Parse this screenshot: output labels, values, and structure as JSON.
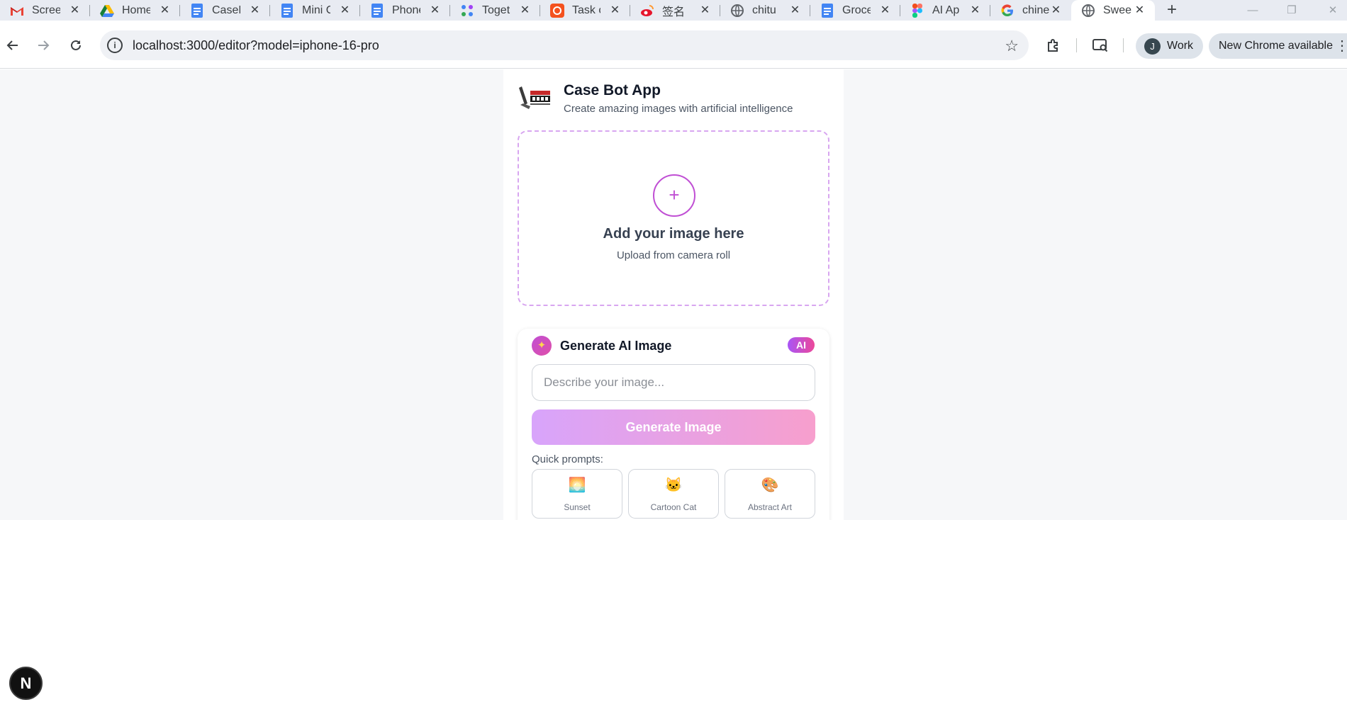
{
  "browser": {
    "tabs": [
      {
        "title": "Screen",
        "icon": "gmail-icon"
      },
      {
        "title": "Home",
        "icon": "google-drive-icon"
      },
      {
        "title": "CaseBot",
        "icon": "google-docs-icon"
      },
      {
        "title": "Mini C",
        "icon": "google-docs-icon"
      },
      {
        "title": "Phone",
        "icon": "google-docs-icon"
      },
      {
        "title": "Together",
        "icon": "apps-icon"
      },
      {
        "title": "Task c",
        "icon": "orange-app-icon"
      },
      {
        "title": "签名",
        "icon": "weibo-icon"
      },
      {
        "title": "chitu",
        "icon": "globe-icon"
      },
      {
        "title": "Groce",
        "icon": "google-docs-icon"
      },
      {
        "title": "AI Ap",
        "icon": "figma-icon"
      },
      {
        "title": "chine",
        "icon": "google-icon"
      },
      {
        "title": "Swee",
        "icon": "globe-icon"
      }
    ],
    "url": "localhost:3000/editor?model=iphone-16-pro",
    "profile_initial": "J",
    "profile_label": "Work",
    "update_label": "New Chrome available"
  },
  "app": {
    "title": "Case Bot App",
    "subtitle": "Create amazing images with artificial intelligence",
    "upload": {
      "title": "Add your image here",
      "subtitle": "Upload from camera roll"
    },
    "generate": {
      "title": "Generate AI Image",
      "badge": "AI",
      "placeholder": "Describe your image...",
      "button_label": "Generate Image",
      "quick_prompts_label": "Quick prompts:",
      "quick_prompts": [
        {
          "emoji": "🌅",
          "label": "Sunset"
        },
        {
          "emoji": "🐱",
          "label": "Cartoon Cat"
        },
        {
          "emoji": "🎨",
          "label": "Abstract Art"
        }
      ]
    }
  },
  "dev_indicator": "N",
  "colors": {
    "accent": "#c04fd4",
    "button_gradient_start": "#d8a4fb",
    "button_gradient_end": "#f79fcd"
  }
}
